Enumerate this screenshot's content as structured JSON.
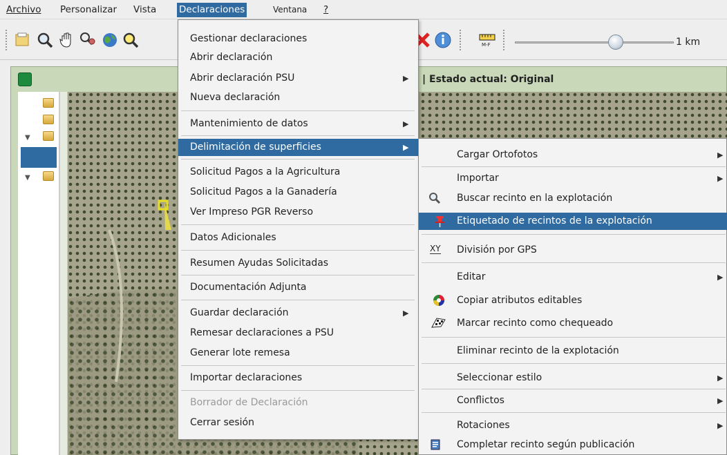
{
  "menubar": {
    "items": [
      {
        "label": "Archivo"
      },
      {
        "label": "Personalizar"
      },
      {
        "label": "Vista"
      },
      {
        "label": "Declaraciones"
      },
      {
        "label": "Ventana"
      },
      {
        "label": "?"
      }
    ]
  },
  "toolbar": {
    "icons": [
      "open-file-icon",
      "zoom-icon",
      "pan-hand-icon",
      "identify-icon",
      "globe-icon",
      "zoom-box-icon",
      "delete-icon",
      "info-icon",
      "measure-icon"
    ],
    "scale_label": "1 km"
  },
  "panel": {
    "title_partial": "Z | Estado actual: Original"
  },
  "declaraciones_menu": {
    "items": [
      {
        "label": "Gestionar declaraciones"
      },
      {
        "label": "Abrir declaración"
      },
      {
        "label": "Abrir declaración PSU"
      },
      {
        "label": "Nueva declaración"
      },
      {
        "label": "Mantenimiento de datos"
      },
      {
        "label": "Delimitación de superficies"
      },
      {
        "label": "Solicitud Pagos a la Agricultura"
      },
      {
        "label": "Solicitud Pagos a la Ganadería"
      },
      {
        "label": "Ver Impreso PGR Reverso"
      },
      {
        "label": "Datos Adicionales"
      },
      {
        "label": "Resumen Ayudas Solicitadas"
      },
      {
        "label": "Documentación Adjunta"
      },
      {
        "label": "Guardar declaración"
      },
      {
        "label": "Remesar declaraciones a PSU"
      },
      {
        "label": "Generar lote remesa"
      },
      {
        "label": "Importar declaraciones"
      },
      {
        "label": "Borrador de Declaración"
      },
      {
        "label": "Cerrar sesión"
      }
    ]
  },
  "delimitacion_submenu": {
    "items": [
      {
        "label": "Cargar Ortofotos"
      },
      {
        "label": "Importar"
      },
      {
        "label": "Buscar recinto en la explotación"
      },
      {
        "label": "Etiquetado de recintos de la explotación"
      },
      {
        "label": "División por GPS"
      },
      {
        "label": "Editar"
      },
      {
        "label": "Copiar atributos editables"
      },
      {
        "label": "Marcar recinto como chequeado"
      },
      {
        "label": "Eliminar recinto de la explotación"
      },
      {
        "label": "Seleccionar estilo"
      },
      {
        "label": "Conflictos"
      },
      {
        "label": "Rotaciones"
      },
      {
        "label": "Completar recinto según publicación"
      }
    ],
    "icon_labels": {
      "gps": "XY"
    }
  },
  "colors": {
    "selection": "#2f6aa0",
    "menu_bg": "#f3f3f3",
    "panel_header": "#c9d8b8"
  }
}
